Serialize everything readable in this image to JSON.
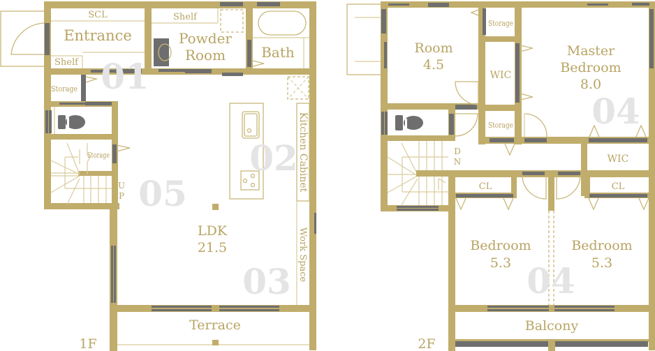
{
  "floors": [
    {
      "label": "1F",
      "rooms": {
        "scl": "SCL",
        "entrance": "Entrance",
        "shelf_entrance": "Shelf",
        "shelf_powder": "Shelf",
        "powder_line1": "Powder",
        "powder_line2": "Room",
        "bath": "Bath",
        "storage_1": "Storage",
        "storage_stair": "Storage",
        "kitchen_cabinet": "Kitchen Cabinet",
        "work_space": "Work Space",
        "ldk_name": "LDK",
        "ldk_size": "21.5",
        "terrace": "Terrace",
        "stair_dir_1": "U",
        "stair_dir_2": "P"
      },
      "markers": [
        "01",
        "02",
        "03",
        "05"
      ]
    },
    {
      "label": "2F",
      "rooms": {
        "room_name": "Room",
        "room_size": "4.5",
        "storage_top": "Storage",
        "storage_mid": "Storage",
        "wic_left": "WIC",
        "wic_right": "WIC",
        "master_line1": "Master",
        "master_line2": "Bedroom",
        "master_size": "8.0",
        "cl_left": "CL",
        "cl_right": "CL",
        "bed_left_name": "Bedroom",
        "bed_left_size": "5.3",
        "bed_right_name": "Bedroom",
        "bed_right_size": "5.3",
        "balcony": "Balcony",
        "stair_dir_1": "D",
        "stair_dir_2": "N"
      },
      "markers": [
        "04",
        "04"
      ]
    }
  ],
  "colors": {
    "wall": "#c0ad6b",
    "window": "#6e6e6e",
    "label": "#b8a463",
    "marker": "#e4e4e4"
  }
}
